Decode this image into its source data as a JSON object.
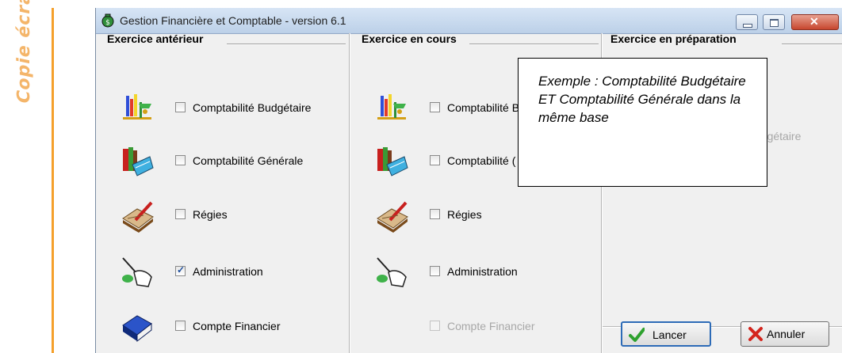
{
  "side_label": "Copie écran",
  "window": {
    "title": "Gestion Financière et Comptable - version 6.1",
    "controls": [
      "minimize",
      "maximize",
      "close"
    ]
  },
  "panels": [
    {
      "title": "Exercice antérieur",
      "items": [
        {
          "icon": "balance-scale-icon",
          "label": "Comptabilité Budgétaire",
          "checked": false,
          "enabled": true
        },
        {
          "icon": "books-icon",
          "label": "Comptabilité Générale",
          "checked": false,
          "enabled": true
        },
        {
          "icon": "ledger-pen-icon",
          "label": "Régies",
          "checked": false,
          "enabled": true
        },
        {
          "icon": "hand-pointer-icon",
          "label": "Administration",
          "checked": true,
          "enabled": true
        },
        {
          "icon": "blue-book-icon",
          "label": "Compte Financier",
          "checked": false,
          "enabled": true
        }
      ]
    },
    {
      "title": "Exercice en cours",
      "items": [
        {
          "icon": "balance-scale-icon",
          "label": "Comptabilité B",
          "checked": false,
          "enabled": true
        },
        {
          "icon": "books-icon",
          "label": "Comptabilité (",
          "checked": false,
          "enabled": true
        },
        {
          "icon": "ledger-pen-icon",
          "label": "Régies",
          "checked": false,
          "enabled": true
        },
        {
          "icon": "hand-pointer-icon",
          "label": "Administration",
          "checked": false,
          "enabled": true
        },
        {
          "icon": "",
          "label": "Compte Financier",
          "checked": false,
          "enabled": false
        }
      ]
    },
    {
      "title": "Exercice en préparation",
      "visible_text": "udgétaire"
    }
  ],
  "buttons": {
    "lancer": "Lancer",
    "annuler": "Annuler"
  },
  "callout": {
    "text": "Exemple : Comptabilité Budgétaire ET Comptabilité Générale dans la même base"
  },
  "colors": {
    "side_label": "#f4b56a",
    "orange_line": "#f5a02b",
    "window_bg": "#f0f0f0",
    "titlebar_top": "#d7e5f5",
    "close_button": "#c7472f"
  }
}
